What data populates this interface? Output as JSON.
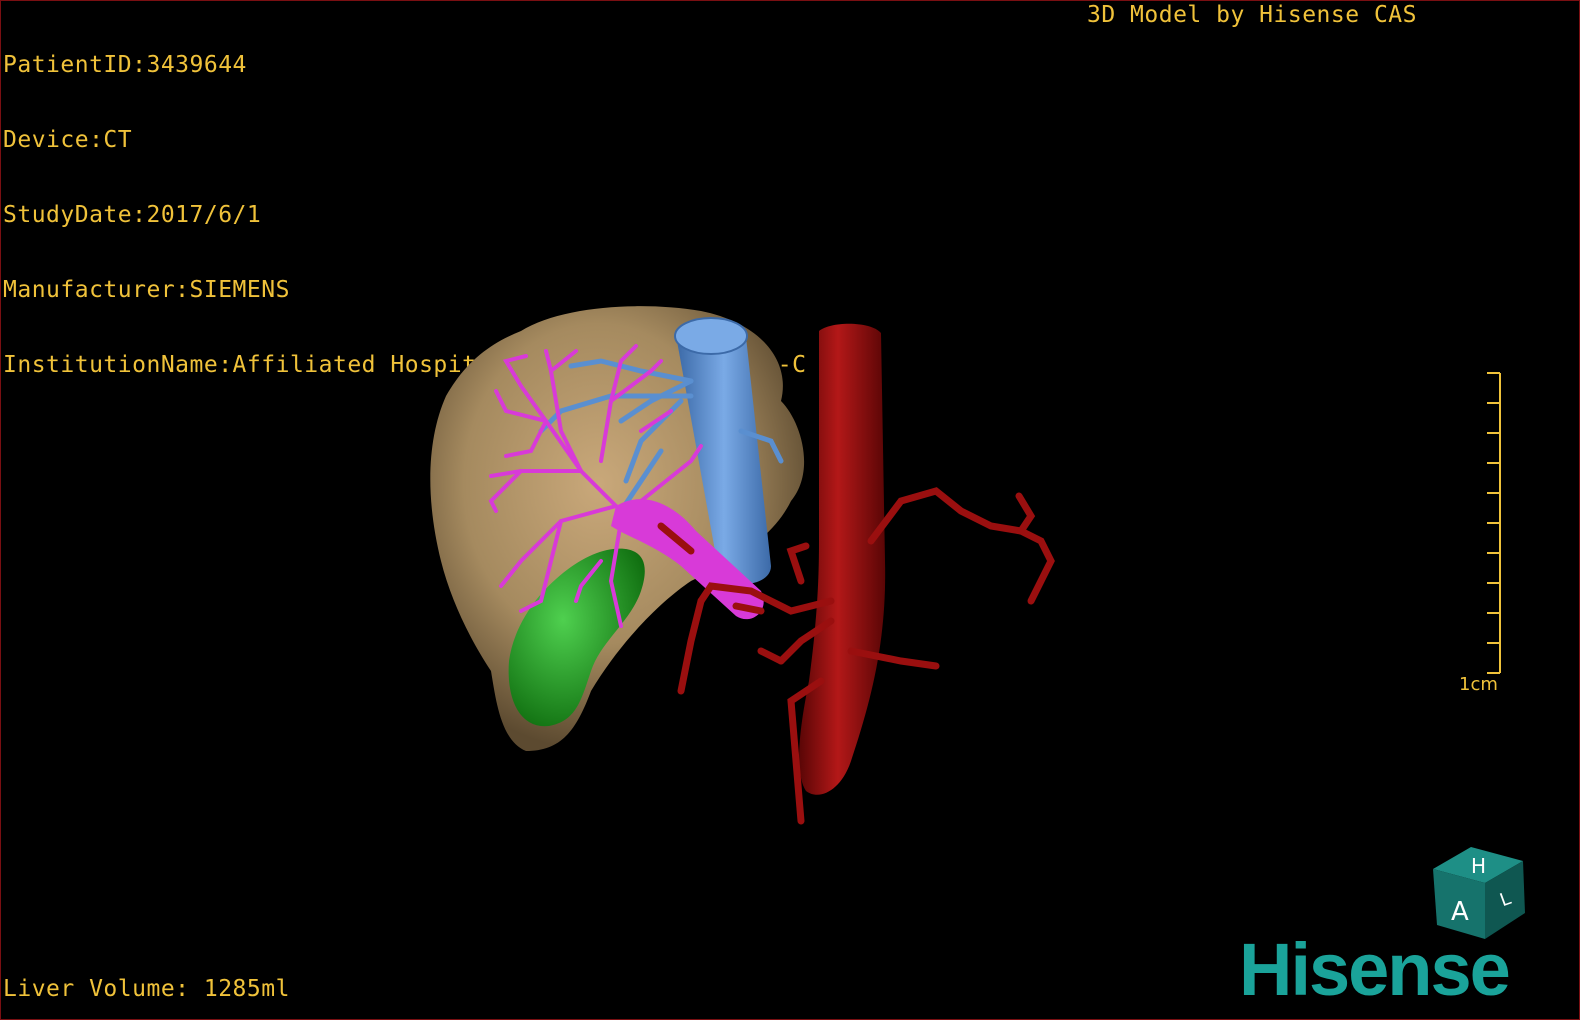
{
  "header": {
    "patient_id": "PatientID:3439644",
    "device": "Device:CT",
    "study_date": "StudyDate:2017/6/1",
    "manufacturer": "Manufacturer:SIEMENS",
    "institution": "InstitutionName:Affiliated Hospital Qingdao University-C",
    "credit": "3D Model by Hisense CAS"
  },
  "footer": {
    "liver_volume": "Liver Volume: 1285ml"
  },
  "scale_bar": {
    "label": "1cm"
  },
  "orientation_cube": {
    "face_top": "H",
    "face_front": "A",
    "face_side": "L"
  },
  "brand": {
    "logo_text": "Hisense"
  },
  "colors": {
    "overlay_text": "#f0c23a",
    "liver": "#a58a5f",
    "portal_vein": "#d83ad8",
    "hepatic_vein": "#5a8fd0",
    "ivc": "#5a8fd0",
    "gallbladder": "#1f9a1f",
    "aorta": "#9a0f0f",
    "brand": "#1aa39a"
  }
}
